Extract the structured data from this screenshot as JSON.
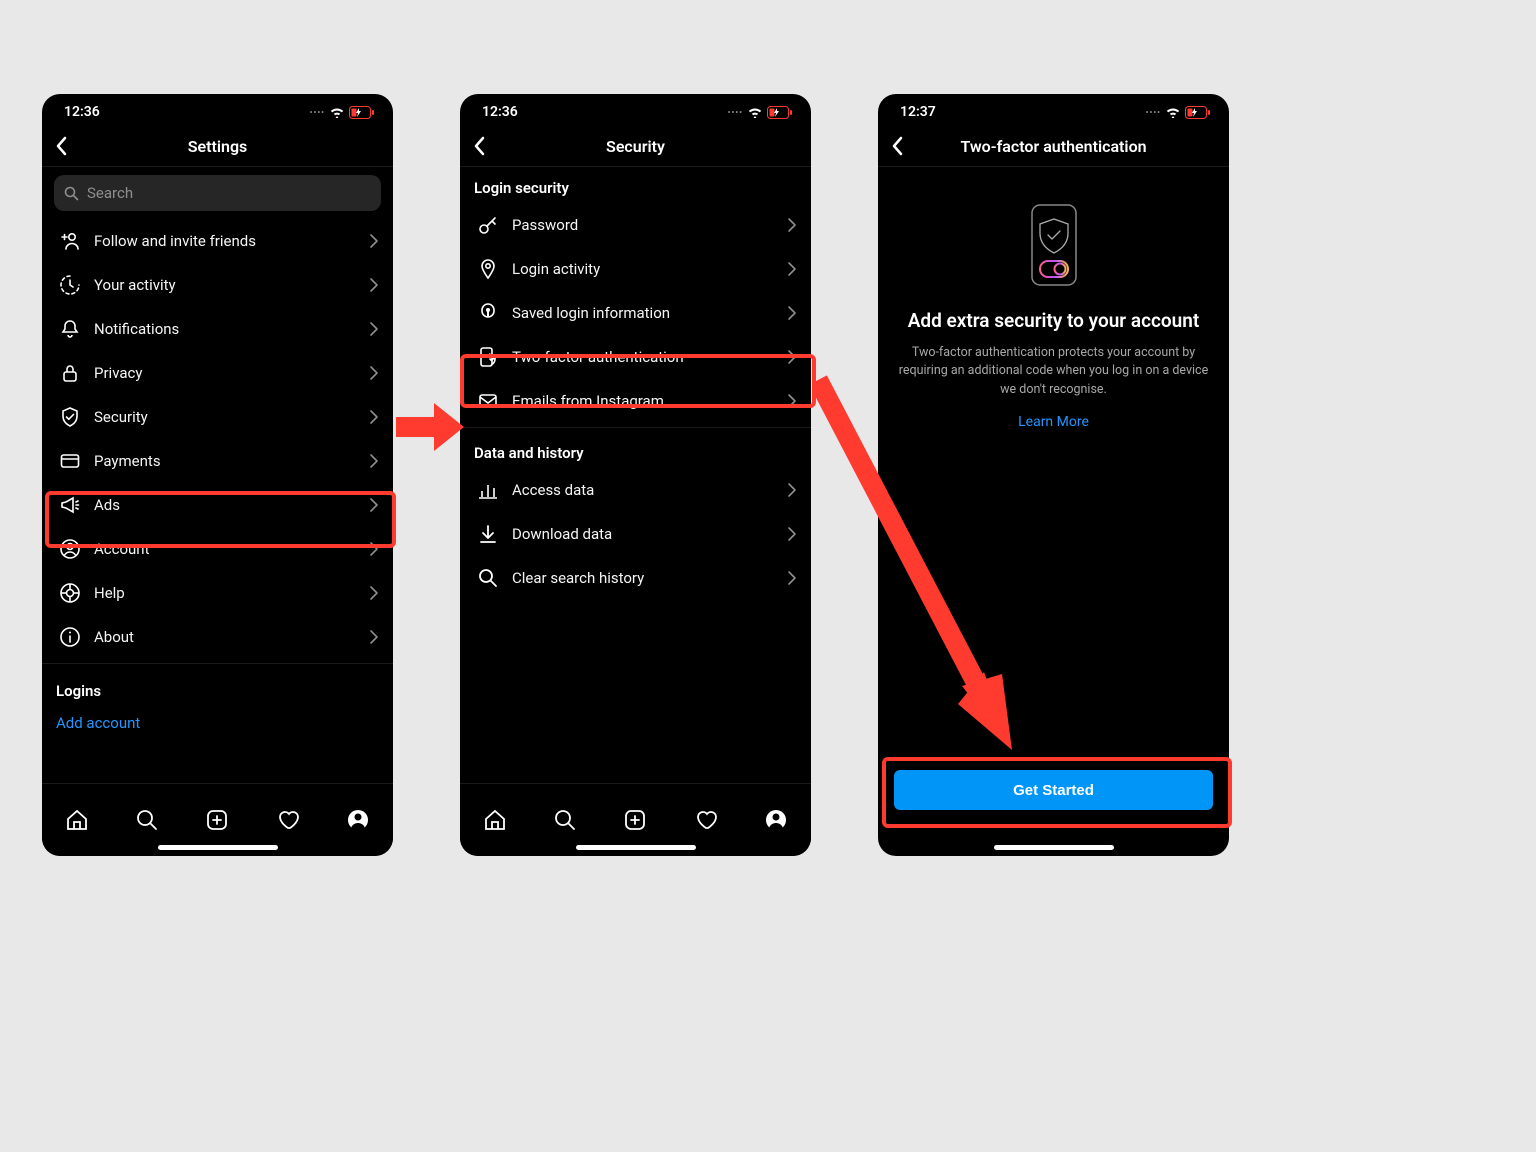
{
  "screens": {
    "settings": {
      "time": "12:36",
      "title": "Settings",
      "search_placeholder": "Search",
      "items": [
        {
          "label": "Follow and invite friends"
        },
        {
          "label": "Your activity"
        },
        {
          "label": "Notifications"
        },
        {
          "label": "Privacy"
        },
        {
          "label": "Security"
        },
        {
          "label": "Payments"
        },
        {
          "label": "Ads"
        },
        {
          "label": "Account"
        },
        {
          "label": "Help"
        },
        {
          "label": "About"
        }
      ],
      "logins_label": "Logins",
      "add_account": "Add account"
    },
    "security": {
      "time": "12:36",
      "title": "Security",
      "section1": "Login security",
      "section1_items": [
        {
          "label": "Password"
        },
        {
          "label": "Login activity"
        },
        {
          "label": "Saved login information"
        },
        {
          "label": "Two-factor authentication"
        },
        {
          "label": "Emails from Instagram"
        }
      ],
      "section2": "Data and history",
      "section2_items": [
        {
          "label": "Access data"
        },
        {
          "label": "Download data"
        },
        {
          "label": "Clear search history"
        }
      ]
    },
    "tfa": {
      "time": "12:37",
      "title": "Two-factor authentication",
      "heading": "Add extra security to your account",
      "description": "Two-factor authentication protects your account by requiring an additional code when you log in on a device we don't recognise.",
      "learn_more": "Learn More",
      "button": "Get Started"
    }
  },
  "highlight_color": "#ff3b30",
  "primary_button_color": "#0095f6"
}
